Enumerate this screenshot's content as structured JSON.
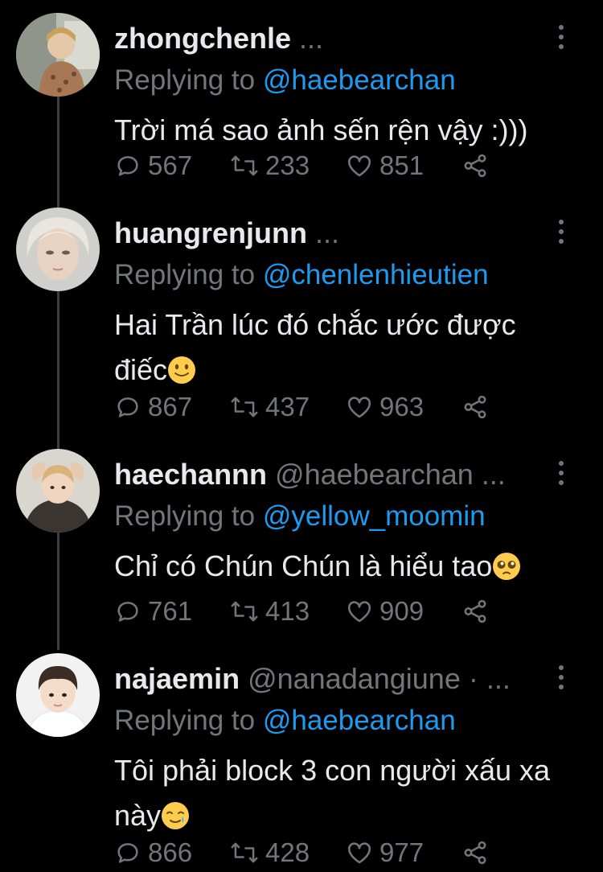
{
  "colors": {
    "background": "#000000",
    "text": "#e7e9ea",
    "secondary": "#71767b",
    "mention": "#1d9bf0",
    "thread_line": "#3a3f44"
  },
  "tweets": [
    {
      "name": "zhongchenle",
      "handle": "",
      "name_suffix": " ...",
      "replying_prefix": "Replying to ",
      "replying_to": "@haebearchan",
      "text": "Trời má sao ảnh sến rện vậy :)))",
      "emoji": "",
      "replies": "567",
      "retweets": "233",
      "likes": "851"
    },
    {
      "name": "huangrenjunn",
      "handle": "",
      "name_suffix": " ...",
      "replying_prefix": "Replying to ",
      "replying_to": "@chenlenhieutien",
      "text": "Hai Trần lúc đó chắc ước được điếc",
      "emoji": "slightly-smiling-face",
      "replies": "867",
      "retweets": "437",
      "likes": "963"
    },
    {
      "name": "haechannn",
      "handle": " @haebearchan",
      "name_suffix": " ...",
      "replying_prefix": "Replying to ",
      "replying_to": "@yellow_moomin",
      "text": "Chỉ có Chún Chún là hiểu tao",
      "emoji": "pleading-face",
      "replies": "761",
      "retweets": "413",
      "likes": "909"
    },
    {
      "name": "najaemin",
      "handle": " @nanadangiune",
      "name_suffix": " · ...",
      "replying_prefix": "Replying to ",
      "replying_to": "@haebearchan",
      "text": "Tôi phải block 3 con người xấu xa này",
      "emoji": "smiling-face-with-tear",
      "replies": "866",
      "retweets": "428",
      "likes": "977"
    }
  ]
}
